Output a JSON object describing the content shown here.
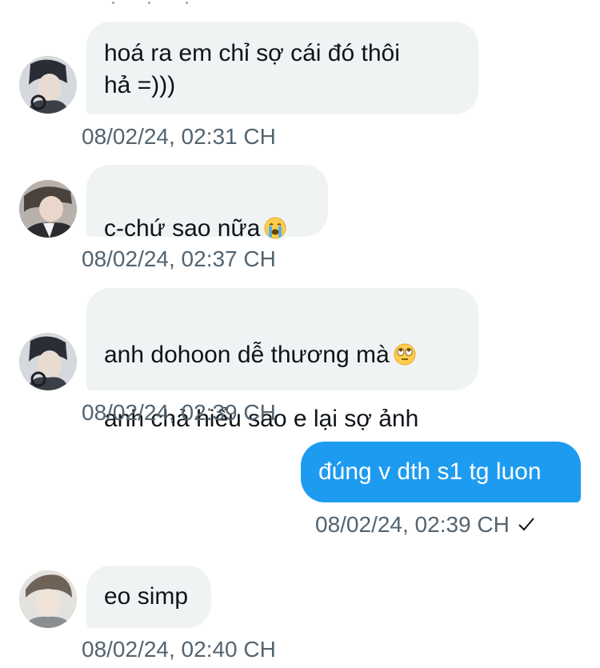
{
  "messages": [
    {
      "text": "hoá ra em chỉ sợ cái đó thôi\nhả =)))",
      "time": "08/02/24, 02:31 CH"
    },
    {
      "text": "c-chứ sao nữa",
      "emoji": "loudly-crying-face-emoji",
      "time": "08/02/24, 02:37 CH"
    },
    {
      "line1": "anh dohoon dễ thương mà",
      "emoji": "rolling-eyes-face-emoji",
      "line2": "anh chả hiểu sao e lại sợ ảnh",
      "time": "08/02/24, 02:39 CH"
    },
    {
      "text": "đúng v dth s1 tg luon",
      "time": "08/02/24, 02:39 CH",
      "status_icon": "checkmark-icon"
    },
    {
      "text": "eo simp",
      "time": "08/02/24, 02:40 CH"
    }
  ],
  "colors": {
    "incoming_bubble": "#eff3f4",
    "outgoing_bubble": "#1d9bf0",
    "timestamp": "#536471",
    "text": "#0f1419"
  }
}
